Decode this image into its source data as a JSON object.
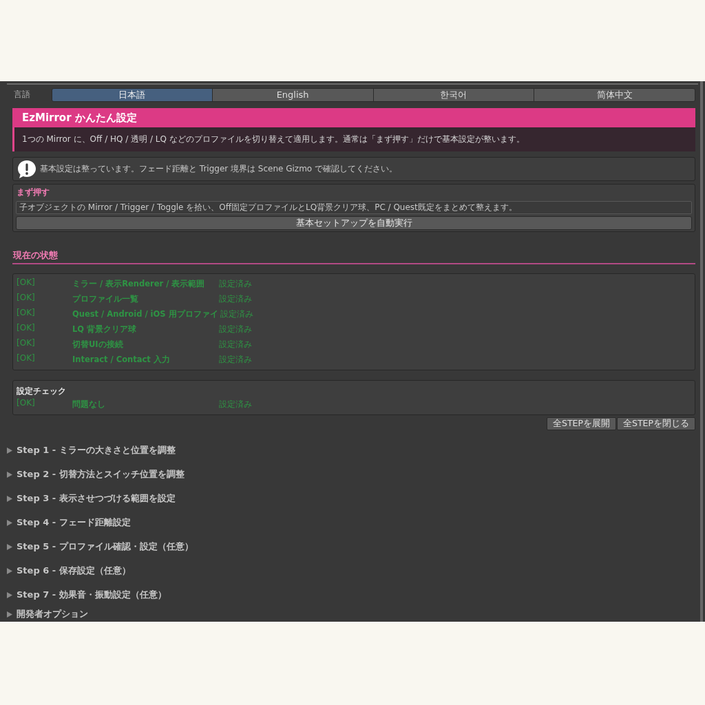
{
  "language": {
    "label": "言語",
    "tabs": [
      {
        "label": "日本語",
        "selected": true
      },
      {
        "label": "English",
        "selected": false
      },
      {
        "label": "한국어",
        "selected": false
      },
      {
        "label": "简体中文",
        "selected": false
      }
    ]
  },
  "header": {
    "title": "EzMirror かんたん設定",
    "description": "1つの Mirror に、Off / HQ / 透明 / LQ などのプロファイルを切り替えて適用します。通常は「まず押す」だけで基本設定が整います。"
  },
  "notice": {
    "text": "基本設定は整っています。フェード距離と Trigger 境界は Scene Gizmo で確認してください。"
  },
  "quick_setup": {
    "title": "まず押す",
    "hint": "子オブジェクトの Mirror / Trigger / Toggle を拾い、Off固定プロファイルとLQ背景クリア球、PC / Quest既定をまとめて整えます。",
    "button": "基本セットアップを自動実行"
  },
  "status": {
    "heading": "現在の状態",
    "rows": [
      {
        "badge": "[OK]",
        "label": "ミラー / 表示Renderer / 表示範囲",
        "state": "設定済み"
      },
      {
        "badge": "[OK]",
        "label": "プロファイル一覧",
        "state": "設定済み"
      },
      {
        "badge": "[OK]",
        "label": "Quest / Android / iOS 用プロファイ",
        "state": "設定済み"
      },
      {
        "badge": "[OK]",
        "label": "LQ 背景クリア球",
        "state": "設定済み"
      },
      {
        "badge": "[OK]",
        "label": "切替UIの接続",
        "state": "設定済み"
      },
      {
        "badge": "[OK]",
        "label": "Interact / Contact 入力",
        "state": "設定済み"
      }
    ]
  },
  "settings_check": {
    "title": "設定チェック",
    "rows": [
      {
        "badge": "[OK]",
        "label": "問題なし",
        "state": "設定済み"
      }
    ]
  },
  "step_buttons": [
    "全STEPを展開",
    "全STEPを閉じる"
  ],
  "foldouts": [
    {
      "label": "Step 1 - ミラーの大きさと位置を調整",
      "expanded": false
    },
    {
      "label": "Step 2 - 切替方法とスイッチ位置を調整",
      "expanded": false
    },
    {
      "label": "Step 3 - 表示させつづける範囲を設定",
      "expanded": false
    },
    {
      "label": "Step 4 - フェード距離設定",
      "expanded": false
    },
    {
      "label": "Step 5 - プロファイル確認・設定（任意）",
      "expanded": false
    },
    {
      "label": "Step 6 - 保存設定（任意）",
      "expanded": false
    },
    {
      "label": "Step 7 - 効果音・振動設定（任意）",
      "expanded": false
    },
    {
      "label": "開発者オプション",
      "expanded": false
    }
  ]
}
